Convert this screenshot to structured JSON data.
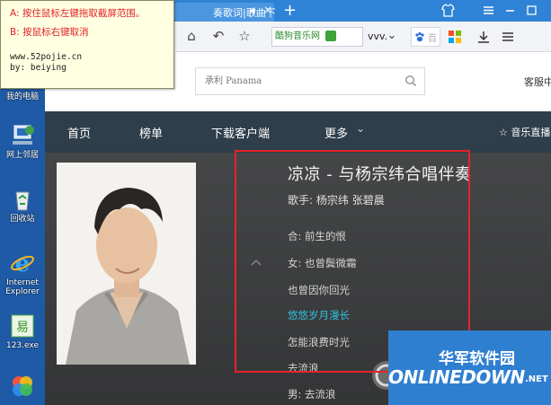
{
  "tooltip": {
    "line_a": "A: 按住鼠标左键拖取截屏范围。",
    "line_b": "B: 按鼠标右键取消",
    "site": "www.52pojie.cn",
    "author": "by: beiying"
  },
  "desktop": {
    "icons": [
      {
        "label": "我的电脑"
      },
      {
        "label": "网上邻居"
      },
      {
        "label": "回收站"
      },
      {
        "label": "Internet Explorer"
      },
      {
        "label": "123.exe"
      },
      {
        "label": ""
      }
    ]
  },
  "browser": {
    "tab_title": "奏歌词|歌曲下",
    "new_tab": "+",
    "toolbar": {
      "home": "⌂",
      "back": "↶",
      "bookmark": "☆",
      "address_segment": "酷狗音乐网",
      "address_more": "vvv.",
      "dropdown": "⌄",
      "baidu_hint": "百"
    }
  },
  "site": {
    "search_placeholder": "承利 Panama",
    "client_link": "客服中",
    "nav": [
      {
        "label": "首页"
      },
      {
        "label": "榜单"
      },
      {
        "label": "下载客户端"
      },
      {
        "label": "更多"
      }
    ],
    "nav_more_arrow": "⌄",
    "nav_right": "☆ 音乐直播",
    "song": {
      "title": "凉凉 - 与杨宗纬合唱伴奏",
      "singer_label": "歌手:",
      "singers": "杨宗纬 张碧晨",
      "lyrics": [
        {
          "text": "合: 前生的恨",
          "highlight": false
        },
        {
          "text": "女: 也曾鬓微霜",
          "highlight": false
        },
        {
          "text": "也曾因你回光",
          "highlight": false
        },
        {
          "text": "悠悠岁月漫长",
          "highlight": true
        },
        {
          "text": "怎能浪费时光",
          "highlight": false
        },
        {
          "text": "去流浪",
          "highlight": false
        },
        {
          "text": "男: 去流浪",
          "highlight": false
        }
      ]
    }
  },
  "watermark": {
    "cn": "华军软件园",
    "en": "ONLINEDOWN",
    "suffix": ".NET"
  },
  "colors": {
    "red": "#e8232b",
    "accent": "#2ec3e0",
    "nav_bg": "#2e3e4a",
    "tab_blue": "#2f83d6"
  }
}
